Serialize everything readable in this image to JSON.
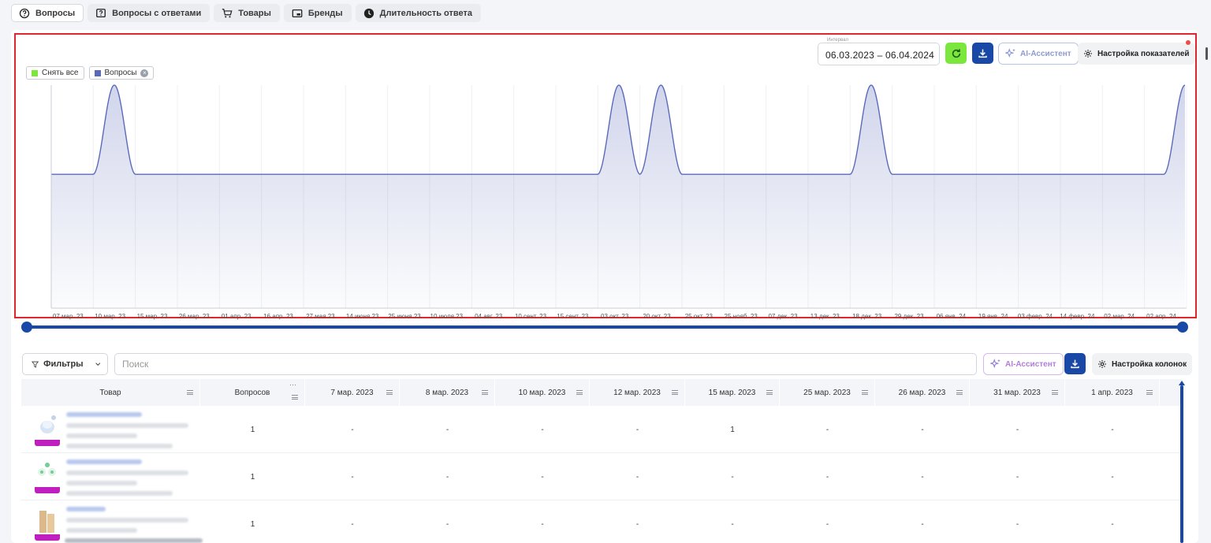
{
  "tabs": [
    {
      "label": "Вопросы",
      "icon": "question-circle-icon",
      "active": true
    },
    {
      "label": "Вопросы с ответами",
      "icon": "question-square-icon",
      "active": false
    },
    {
      "label": "Товары",
      "icon": "cart-icon",
      "active": false
    },
    {
      "label": "Бренды",
      "icon": "brand-card-icon",
      "active": false
    },
    {
      "label": "Длительность ответа",
      "icon": "clock-icon",
      "active": false
    }
  ],
  "toolbar": {
    "interval_label": "Интервал",
    "interval_value": "06.03.2023 – 06.04.2024",
    "ai_label": "AI-Ассистент",
    "settings_label": "Настройка показателей"
  },
  "legend": {
    "clear_all": "Снять все",
    "series_label": "Вопросы",
    "clear_color": "#7be63b",
    "series_color": "#5b6ab8"
  },
  "chart_data": {
    "type": "area",
    "series": [
      {
        "name": "Вопросы",
        "values": [
          0,
          1,
          0,
          0,
          0,
          0,
          0,
          0,
          0,
          0,
          0,
          0,
          0,
          0,
          1,
          1,
          0,
          0,
          0,
          0,
          1,
          0,
          0,
          0,
          0,
          0,
          0,
          1
        ]
      }
    ],
    "x": [
      "07 мар. 23",
      "10 мар. 23",
      "15 мар. 23",
      "26 мар. 23",
      "01 апр. 23",
      "16 апр. 23",
      "27 мая 23",
      "14 июня 23",
      "25 июня 23",
      "10 июля 23",
      "04 авг. 23",
      "10 сент. 23",
      "15 сент. 23",
      "03 окт. 23",
      "20 окт. 23",
      "25 окт. 23",
      "25 нояб. 23",
      "07 дек. 23",
      "13 дек. 23",
      "18 дек. 23",
      "29 дек. 23",
      "06 янв. 24",
      "19 янв. 24",
      "03 февр. 24",
      "14 февр. 24",
      "02 мар. 24",
      "02 апр. 24"
    ],
    "peaks_at": [
      "10 мар. 23",
      "03 окт. 23",
      "20 окт. 23",
      "18 дек. 23",
      "02 апр. 24"
    ],
    "ylim": [
      -1.5,
      1
    ],
    "grid": true,
    "color": "#5b6ab8"
  },
  "filters": {
    "label": "Фильтры"
  },
  "search": {
    "placeholder": "Поиск"
  },
  "table_toolbar": {
    "ai_label": "AI-Ассистент",
    "columns_label": "Настройка колонок"
  },
  "table": {
    "columns": [
      "Товар",
      "Вопросов",
      "7 мар. 2023",
      "8 мар. 2023",
      "10 мар. 2023",
      "12 мар. 2023",
      "15 мар. 2023",
      "25 мар. 2023",
      "26 мар. 2023",
      "31 мар. 2023",
      "1 апр. 2023"
    ],
    "rows": [
      {
        "questions": "1",
        "cells": [
          "-",
          "-",
          "-",
          "-",
          "1",
          "-",
          "-",
          "-",
          "-"
        ]
      },
      {
        "questions": "1",
        "cells": [
          "-",
          "-",
          "-",
          "-",
          "-",
          "-",
          "-",
          "-",
          "-"
        ]
      },
      {
        "questions": "1",
        "cells": [
          "-",
          "-",
          "-",
          "-",
          "-",
          "-",
          "-",
          "-",
          "-"
        ]
      }
    ]
  }
}
